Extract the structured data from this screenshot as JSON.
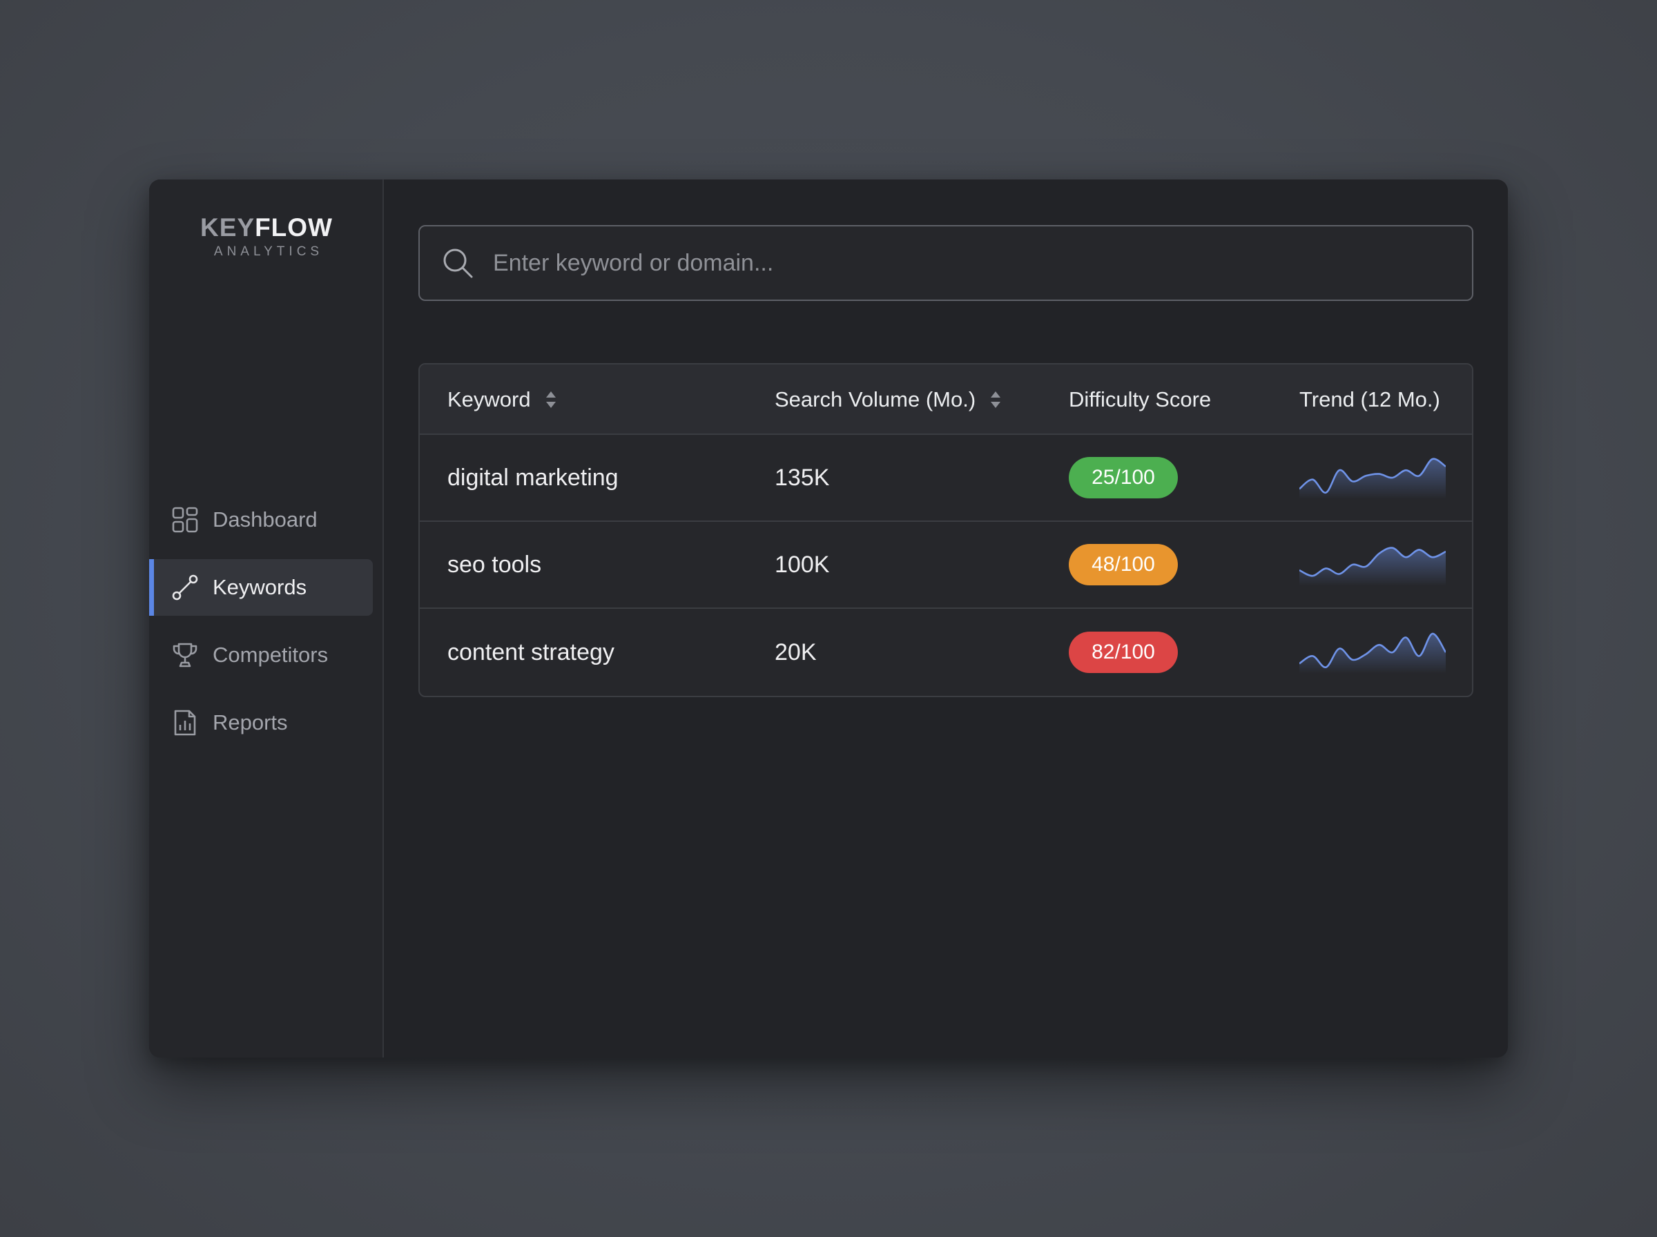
{
  "brand": {
    "word_a": "KEY",
    "word_b": "FLOW",
    "subtitle": "ANALYTICS"
  },
  "sidebar": {
    "items": [
      {
        "label": "Dashboard",
        "icon": "dashboard-icon",
        "active": false
      },
      {
        "label": "Keywords",
        "icon": "keywords-icon",
        "active": true
      },
      {
        "label": "Competitors",
        "icon": "trophy-icon",
        "active": false
      },
      {
        "label": "Reports",
        "icon": "reports-icon",
        "active": false
      }
    ]
  },
  "search": {
    "placeholder": "Enter keyword or domain...",
    "value": ""
  },
  "table": {
    "columns": [
      "Keyword",
      "Search Volume (Mo.)",
      "Difficulty Score",
      "Trend (12 Mo.)"
    ],
    "rows": [
      {
        "keyword": "digital marketing",
        "volume": "135K",
        "difficulty": "25/100",
        "difficulty_color": "#4caf50",
        "trend": [
          0.2,
          0.45,
          0.1,
          0.7,
          0.4,
          0.55,
          0.6,
          0.5,
          0.7,
          0.55,
          1.0,
          0.8
        ]
      },
      {
        "keyword": "seo tools",
        "volume": "100K",
        "difficulty": "48/100",
        "difficulty_color": "#e8952e",
        "trend": [
          0.35,
          0.2,
          0.4,
          0.25,
          0.5,
          0.45,
          0.8,
          0.95,
          0.7,
          0.9,
          0.7,
          0.85
        ]
      },
      {
        "keyword": "content strategy",
        "volume": "20K",
        "difficulty": "82/100",
        "difficulty_color": "#dc4545",
        "trend": [
          0.2,
          0.4,
          0.1,
          0.6,
          0.3,
          0.45,
          0.7,
          0.5,
          0.9,
          0.4,
          1.0,
          0.5
        ]
      }
    ]
  },
  "colors": {
    "accent": "#5b86e5",
    "spark_line": "#6f93e8"
  }
}
